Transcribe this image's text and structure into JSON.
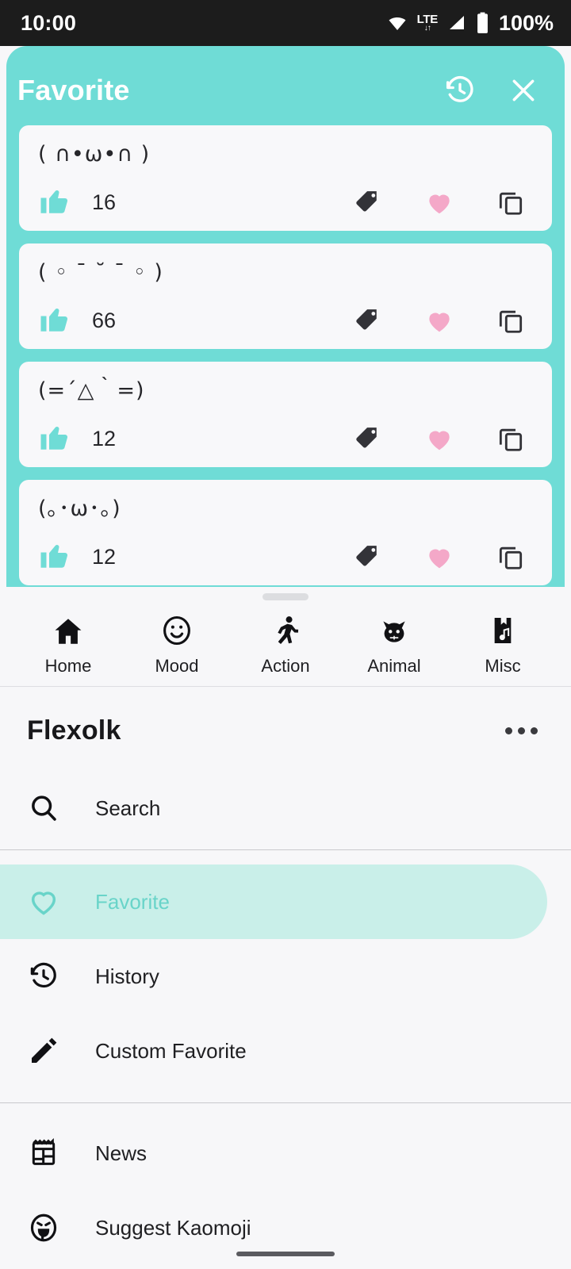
{
  "status_bar": {
    "time": "10:00",
    "network_type": "LTE",
    "network_arrows": "↓↑",
    "battery_percent": "100%",
    "icons": [
      "wifi-icon",
      "lte-icon",
      "cellular-signal-icon",
      "battery-icon"
    ]
  },
  "favorite_panel": {
    "title": "Favorite",
    "accent_color": "#6fdcd6",
    "history_icon": "history-icon",
    "close_icon": "close-icon",
    "items": [
      {
        "kaomoji": "( ∩•ω•∩ )",
        "likes": "16",
        "tag_icon": "tag-icon",
        "heart_icon": "heart-filled-icon",
        "copy_icon": "copy-icon"
      },
      {
        "kaomoji": "( ◦ ˉ ˘ ˉ ◦ )",
        "likes": "66",
        "tag_icon": "tag-icon",
        "heart_icon": "heart-filled-icon",
        "copy_icon": "copy-icon"
      },
      {
        "kaomoji": "(=´△｀=)",
        "likes": "12",
        "tag_icon": "tag-icon",
        "heart_icon": "heart-filled-icon",
        "copy_icon": "copy-icon"
      },
      {
        "kaomoji": "(｡･ω･｡)",
        "likes": "12",
        "tag_icon": "tag-icon",
        "heart_icon": "heart-filled-icon",
        "copy_icon": "copy-icon"
      }
    ],
    "like_color": "#6fdcd6",
    "heart_color": "#f4a8c8"
  },
  "bottom_sheet": {
    "tabs": [
      {
        "label": "Home",
        "icon": "home-icon"
      },
      {
        "label": "Mood",
        "icon": "smiley-icon"
      },
      {
        "label": "Action",
        "icon": "running-person-icon"
      },
      {
        "label": "Animal",
        "icon": "cat-icon"
      },
      {
        "label": "Misc",
        "icon": "misc-music-icon"
      }
    ],
    "app_name": "Flexolk",
    "overflow_icon": "more-horizontal-icon",
    "search": {
      "label": "Search",
      "icon": "search-icon"
    },
    "menu": [
      {
        "label": "Favorite",
        "icon": "heart-outline-icon",
        "selected": true
      },
      {
        "label": "History",
        "icon": "history-icon",
        "selected": false
      },
      {
        "label": "Custom Favorite",
        "icon": "pencil-icon",
        "selected": false
      },
      {
        "label": "News",
        "icon": "news-icon",
        "selected": false
      },
      {
        "label": "Suggest Kaomoji",
        "icon": "suggest-face-icon",
        "selected": false
      }
    ],
    "selected_bg_color": "#c9efe9",
    "selected_text_color": "#69d4c9"
  }
}
